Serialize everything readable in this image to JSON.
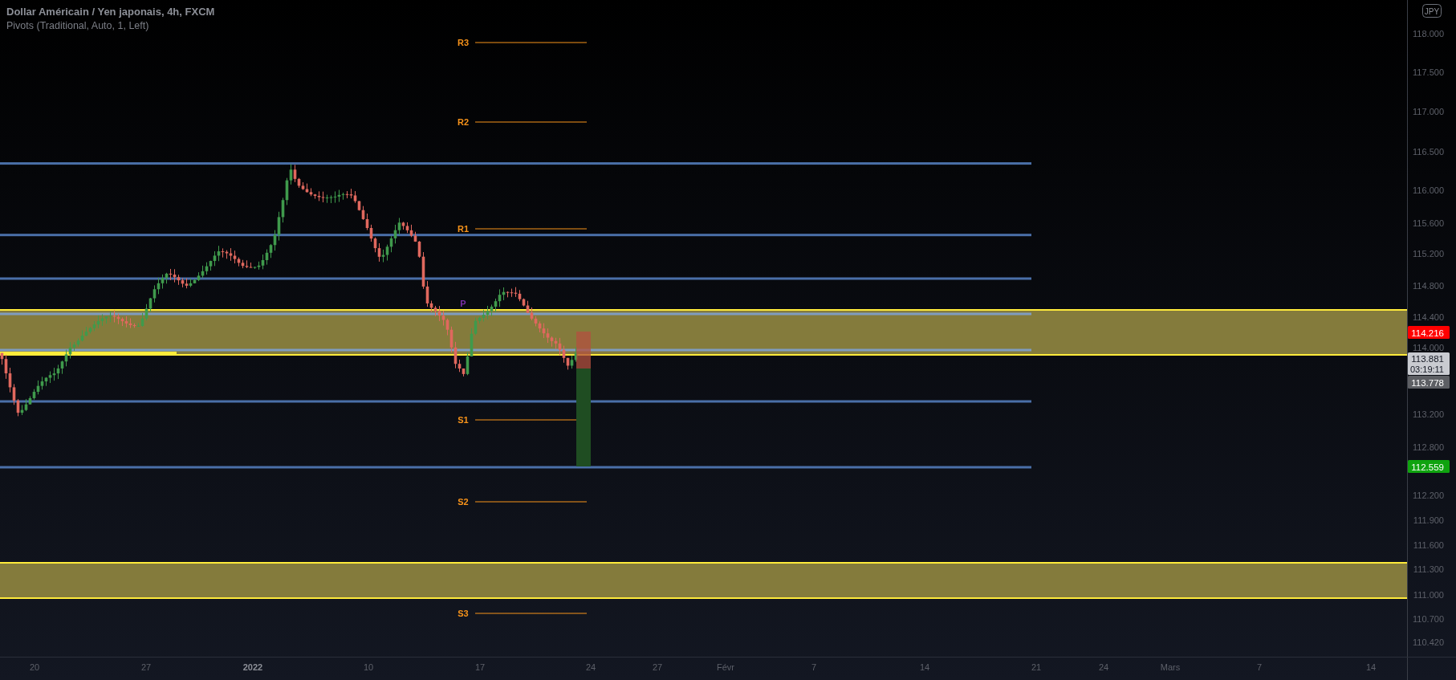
{
  "legend": {
    "title": "Dollar Américain / Yen japonais, 4h, FXCM",
    "indicator": "Pivots (Traditional, Auto, 1, Left)"
  },
  "currency_badge": "JPY",
  "pivots": [
    {
      "label": "R3",
      "color": "#f7931a"
    },
    {
      "label": "R2",
      "color": "#f7931a"
    },
    {
      "label": "R1",
      "color": "#f7931a"
    },
    {
      "label": "P",
      "color": "#7b2fa8"
    },
    {
      "label": "S1",
      "color": "#f7931a"
    },
    {
      "label": "S2",
      "color": "#f7931a"
    },
    {
      "label": "S3",
      "color": "#f7931a"
    }
  ],
  "price_axis": {
    "ticks": [
      "118.000",
      "117.500",
      "117.000",
      "116.500",
      "116.000",
      "115.600",
      "115.200",
      "114.800",
      "114.400",
      "114.000",
      "113.200",
      "112.800",
      "112.200",
      "111.900",
      "111.600",
      "111.300",
      "111.000",
      "110.700",
      "110.420"
    ]
  },
  "price_tags": [
    {
      "kind": "stop",
      "text": "114.216"
    },
    {
      "kind": "last",
      "text": "113.881",
      "countdown": "03:19:11"
    },
    {
      "kind": "previous",
      "text": "113.778"
    },
    {
      "kind": "target",
      "text": "112.559"
    }
  ],
  "time_axis": {
    "ticks": [
      {
        "label": "20",
        "bold": false
      },
      {
        "label": "27",
        "bold": false
      },
      {
        "label": "2022",
        "bold": true
      },
      {
        "label": "10",
        "bold": false
      },
      {
        "label": "17",
        "bold": false
      },
      {
        "label": "24",
        "bold": false
      },
      {
        "label": "27",
        "bold": false
      },
      {
        "label": "Févr",
        "bold": false
      },
      {
        "label": "7",
        "bold": false
      },
      {
        "label": "14",
        "bold": false
      },
      {
        "label": "21",
        "bold": false
      },
      {
        "label": "24",
        "bold": false
      },
      {
        "label": "Mars",
        "bold": false
      },
      {
        "label": "7",
        "bold": false
      },
      {
        "label": "14",
        "bold": false
      }
    ]
  }
}
